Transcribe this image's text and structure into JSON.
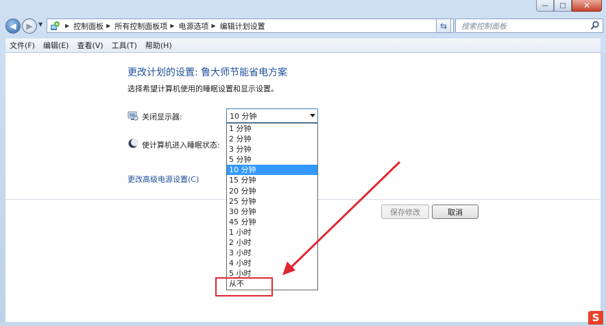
{
  "window": {
    "caption_min": "—",
    "caption_max": "□",
    "caption_close": "✕"
  },
  "address": {
    "crumbs": [
      "控制面板",
      "所有控制面板项",
      "电源选项",
      "编辑计划设置"
    ],
    "search_placeholder": "搜索控制面板"
  },
  "menu": [
    "文件(F)",
    "编辑(E)",
    "查看(V)",
    "工具(T)",
    "帮助(H)"
  ],
  "content": {
    "title": "更改计划的设置: 鲁大师节能省电方案",
    "subtitle": "选择希望计算机使用的睡眠设置和显示设置。",
    "display_off_label": "关闭显示器:",
    "sleep_label": "使计算机进入睡眠状态:",
    "display_off_value": "10 分钟",
    "advanced_link": "更改高级电源设置(C)",
    "save_button": "保存修改",
    "cancel_button": "取消"
  },
  "dropdown": {
    "options": [
      "1 分钟",
      "2 分钟",
      "3 分钟",
      "5 分钟",
      "10 分钟",
      "15 分钟",
      "20 分钟",
      "25 分钟",
      "30 分钟",
      "45 分钟",
      "1 小时",
      "2 小时",
      "3 小时",
      "4 小时",
      "5 小时",
      "从不"
    ],
    "selected_index": 4
  },
  "badge": "S",
  "colors": {
    "annotation": "#e0262f",
    "selection": "#3399ff",
    "link": "#1d4f9c"
  }
}
